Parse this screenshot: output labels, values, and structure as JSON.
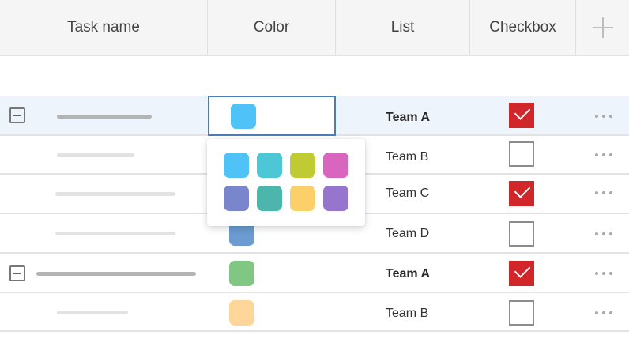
{
  "header": {
    "columns": [
      {
        "id": "task",
        "label": "Task name"
      },
      {
        "id": "color",
        "label": "Color"
      },
      {
        "id": "list",
        "label": "List"
      },
      {
        "id": "checkbox",
        "label": "Checkbox"
      }
    ],
    "add_column_icon": "plus-icon"
  },
  "rows": [
    {
      "type": "parent",
      "color": "#4fc3f7",
      "list": "Team A",
      "checked": true,
      "editing": true
    },
    {
      "type": "child",
      "color": "",
      "list": "Team B",
      "checked": false
    },
    {
      "type": "child",
      "color": "",
      "list": "Team C",
      "checked": true
    },
    {
      "type": "child",
      "color": "#6b9bd1",
      "list": "Team D",
      "checked": false
    },
    {
      "type": "parent",
      "color": "#81c784",
      "list": "Team A",
      "checked": true
    },
    {
      "type": "child",
      "color": "#ffd699",
      "list": "Team B",
      "checked": false
    }
  ],
  "color_picker": {
    "options": [
      "#4fc3f7",
      "#4dc6d6",
      "#c0ca33",
      "#d965bf",
      "#7986cb",
      "#4db6ac",
      "#fbd06a",
      "#9575cd"
    ]
  },
  "accents": {
    "checkbox_checked": "#d1262a",
    "selected_row": "#edf4fc",
    "editing_border": "#4d7db8"
  }
}
